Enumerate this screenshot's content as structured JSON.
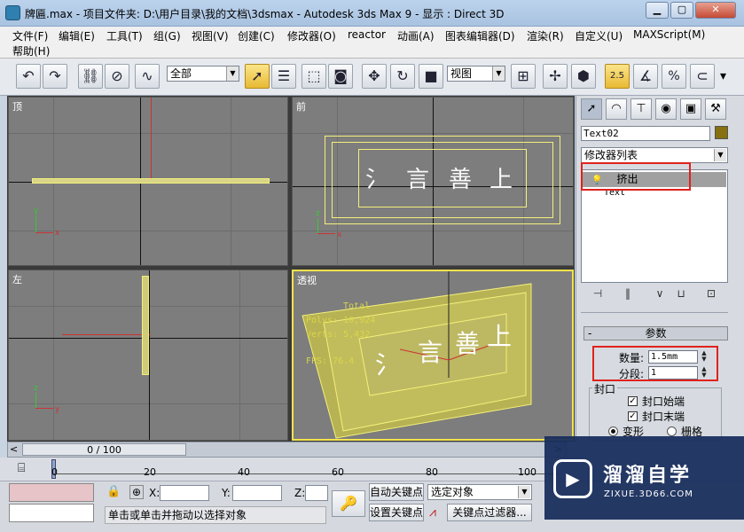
{
  "window": {
    "title": "牌匾.max    - 项目文件夹: D:\\用户目录\\我的文档\\3dsmax    - Autodesk 3ds Max 9      - 显示 : Direct 3D",
    "minimize": "▁",
    "maximize": "▢",
    "close": "✕"
  },
  "menu": [
    "文件(F)",
    "编辑(E)",
    "工具(T)",
    "组(G)",
    "视图(V)",
    "创建(C)",
    "修改器(O)",
    "reactor",
    "动画(A)",
    "图表编辑器(D)",
    "渲染(R)",
    "自定义(U)",
    "MAXScript(M)",
    "帮助(H)"
  ],
  "toolbar": {
    "selection_filter": "全部",
    "ref_coord": "视图",
    "snap_angle_label": "2.5",
    "percent_snap": "%",
    "icons": [
      "undo-icon",
      "redo-icon",
      "link-icon",
      "unlink-icon",
      "bind-spacewarp-icon",
      "select-icon",
      "select-by-name-icon",
      "rect-region-icon",
      "window-crossing-icon",
      "move-icon",
      "rotate-icon",
      "scale-icon",
      "pivot-icon",
      "mirror-icon",
      "align-icon",
      "snap-icon",
      "angle-snap-icon",
      "percent-snap-icon",
      "spinner-snap-icon"
    ]
  },
  "viewports": {
    "top": {
      "label": "顶"
    },
    "front": {
      "label": "前"
    },
    "left": {
      "label": "左"
    },
    "perspective": {
      "label": "透视",
      "stats": {
        "total": "Total",
        "polys": "Polys: 10,924",
        "verts": "Verts: 5,432",
        "fps": "FPS:   76.4"
      }
    },
    "axis_x": "x",
    "axis_y": "y",
    "axis_z": "z"
  },
  "command_panel": {
    "object_name": "Text02",
    "object_color": "#86700f",
    "modifier_list": "修改器列表",
    "stack": [
      {
        "label": "挤出",
        "selected": true
      },
      {
        "label": "Text",
        "selected": false
      }
    ],
    "parameters": {
      "header": "参数",
      "amount_label": "数量:",
      "amount_value": "1.5mm",
      "segments_label": "分段:",
      "segments_value": "1",
      "capping_title": "封口",
      "cap_start": {
        "label": "封口始端",
        "checked": true
      },
      "cap_end": {
        "label": "封口末端",
        "checked": true
      },
      "morph": {
        "label": "变形",
        "selected": true
      },
      "grid": {
        "label": "栅格",
        "selected": false
      }
    }
  },
  "timeline": {
    "position": "0 / 100",
    "ticks": [
      "0",
      "20",
      "40",
      "60",
      "80",
      "100"
    ]
  },
  "status": {
    "x_label": "X:",
    "y_label": "Y:",
    "z_label": "Z:",
    "auto_key": "自动关键点",
    "set_key": "设置关键点",
    "selected_object": "选定对象",
    "key_filters": "关键点过滤器...",
    "prompt": "单击或单击并拖动以选择对象"
  },
  "watermark": {
    "title": "溜溜自学",
    "url": "ZIXUE.3D66.COM"
  }
}
